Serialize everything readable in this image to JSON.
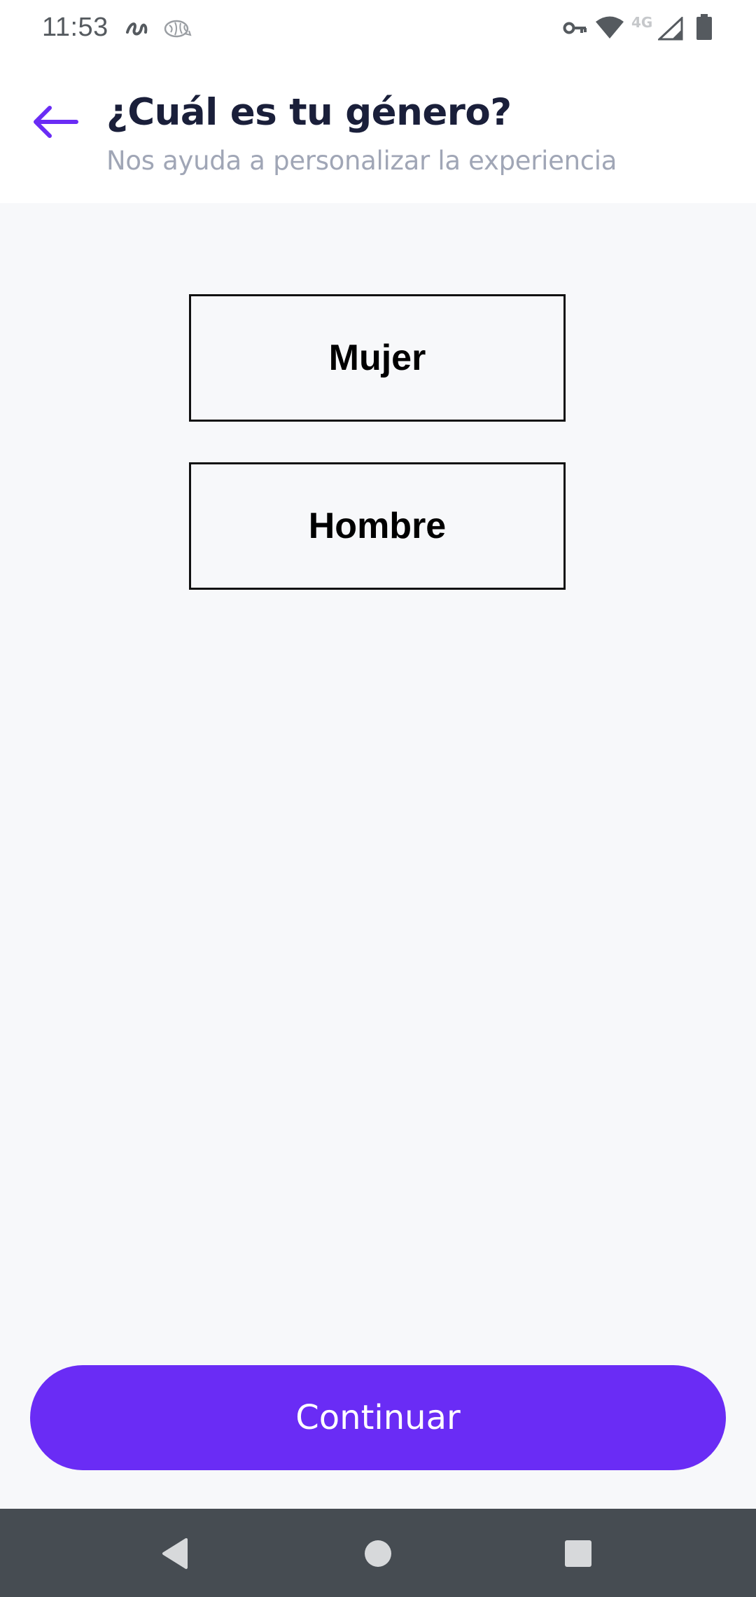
{
  "status_bar": {
    "time": "11:53",
    "network_label": "4G",
    "icons": [
      "swirl-app-icon",
      "brain-app-icon",
      "vpn-key-icon",
      "wifi-icon",
      "cell-signal-icon",
      "battery-icon"
    ]
  },
  "header": {
    "back_icon": "arrow-left-icon",
    "title": "¿Cuál es tu género?",
    "subtitle": "Nos ayuda a personalizar la experiencia"
  },
  "options": [
    {
      "label": "Mujer"
    },
    {
      "label": "Hombre"
    }
  ],
  "continue_label": "Continuar",
  "nav_bar": {
    "icons": [
      "back-triangle-icon",
      "home-circle-icon",
      "recents-square-icon"
    ]
  },
  "colors": {
    "accent": "#6a2cf5",
    "title": "#1a1f3a",
    "subtitle": "#a0a6b6",
    "background": "#f7f8fa",
    "nav_bar": "#464c52"
  }
}
